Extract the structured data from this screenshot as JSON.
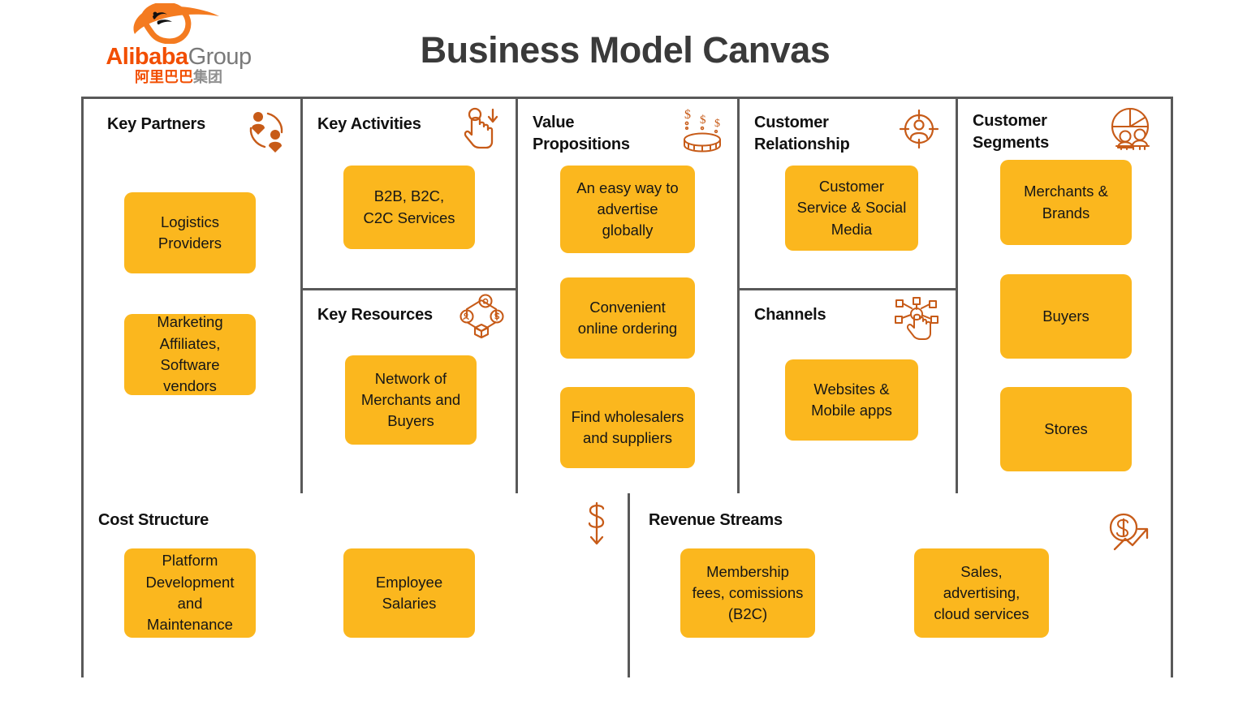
{
  "header": {
    "logo": {
      "brand_primary": "Alibaba",
      "brand_secondary": "Group",
      "chinese_main": "阿里巴巴",
      "chinese_dim": "集团",
      "mark_icon": "alibaba-a-mark-icon"
    },
    "title": "Business Model Canvas"
  },
  "colors": {
    "card": "#FBB71E",
    "icon_orange": "#C75B18",
    "logo_orange": "#F24E00",
    "border_gray": "#595959",
    "title_gray": "#3A3A3A",
    "text_black": "#161616"
  },
  "canvas": {
    "blocks": [
      {
        "key": "key-partners",
        "title": "Key Partners",
        "icon": "partners-network-icon",
        "cards": [
          {
            "text": "Logistics\nProviders"
          },
          {
            "text": "Marketing\nAffiliates,\nSoftware vendors"
          }
        ]
      },
      {
        "key": "key-activities",
        "title": "Key Activities",
        "icon": "pointing-hand-download-icon",
        "cards": [
          {
            "text": "B2B, B2C,\nC2C Services"
          }
        ]
      },
      {
        "key": "key-resources",
        "title": "Key Resources",
        "icon": "resources-diamond-icon",
        "cards": [
          {
            "text": "Network of\nMerchants and\nBuyers"
          }
        ]
      },
      {
        "key": "value-propositions",
        "title": "Value\nPropositions",
        "icon": "coin-dollars-icon",
        "cards": [
          {
            "text": "An easy way to\nadvertise\nglobally"
          },
          {
            "text": "Convenient\nonline ordering"
          },
          {
            "text": "Find wholesalers\nand suppliers"
          }
        ]
      },
      {
        "key": "customer-relationship",
        "title": "Customer\nRelationship",
        "icon": "target-person-icon",
        "cards": [
          {
            "text": "Customer\nService & Social\nMedia"
          }
        ]
      },
      {
        "key": "channels",
        "title": "Channels",
        "icon": "hand-network-touch-icon",
        "cards": [
          {
            "text": "Websites &\nMobile apps"
          }
        ]
      },
      {
        "key": "customer-segments",
        "title": "Customer\nSegments",
        "icon": "pie-chart-people-icon",
        "cards": [
          {
            "text": "Merchants &\nBrands"
          },
          {
            "text": "Buyers"
          },
          {
            "text": "Stores"
          }
        ]
      },
      {
        "key": "cost-structure",
        "title": "Cost Structure",
        "icon": "dollar-down-arrow-icon",
        "cards": [
          {
            "text": "Platform\nDevelopment and\nMaintenance"
          },
          {
            "text": "Employee\nSalaries"
          }
        ]
      },
      {
        "key": "revenue-streams",
        "title": "Revenue Streams",
        "icon": "dollar-growth-arrow-icon",
        "cards": [
          {
            "text": "Membership\nfees, comissions\n(B2C)"
          },
          {
            "text": "Sales,\nadvertising,\ncloud services"
          }
        ]
      }
    ]
  }
}
